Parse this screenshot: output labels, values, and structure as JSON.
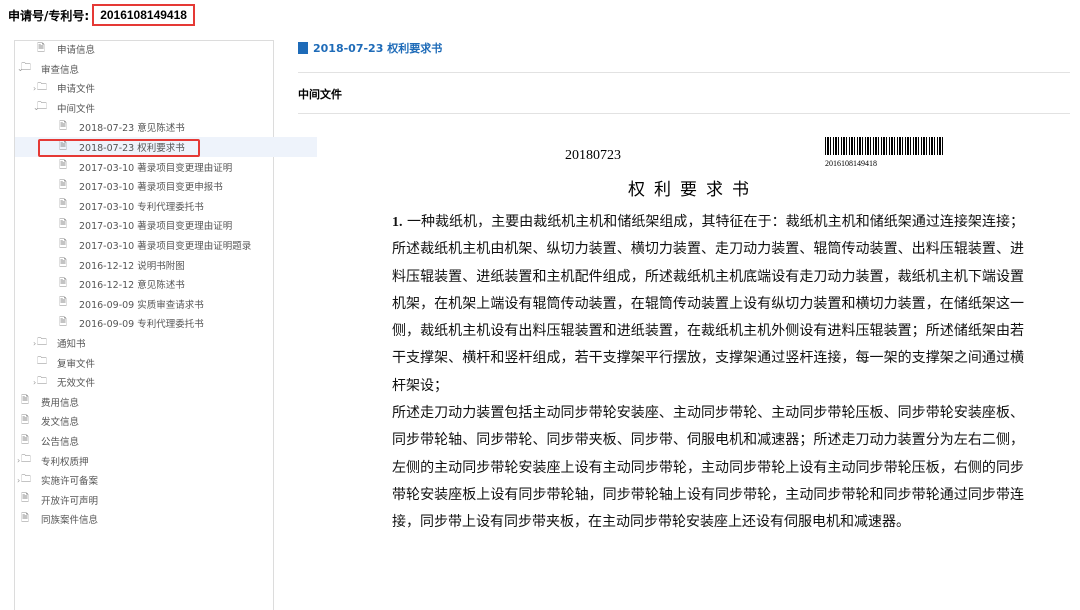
{
  "header": {
    "label": "申请号/专利号:",
    "number": "2016108149418"
  },
  "tree": [
    {
      "label": "申请信息",
      "icon": "doc",
      "arrow": ""
    },
    {
      "label": "审查信息",
      "icon": "folder",
      "arrow": "⌄"
    },
    {
      "label": "申请文件",
      "icon": "folder",
      "arrow": "›"
    },
    {
      "label": "中间文件",
      "icon": "folder",
      "arrow": "⌄"
    },
    {
      "label": "2018-07-23 意见陈述书",
      "icon": "doc",
      "arrow": ""
    },
    {
      "label": "2018-07-23 权利要求书",
      "icon": "doc",
      "arrow": ""
    },
    {
      "label": "2017-03-10 著录项目变更理由证明",
      "icon": "doc",
      "arrow": ""
    },
    {
      "label": "2017-03-10 著录项目变更申报书",
      "icon": "doc",
      "arrow": ""
    },
    {
      "label": "2017-03-10 专利代理委托书",
      "icon": "doc",
      "arrow": ""
    },
    {
      "label": "2017-03-10 著录项目变更理由证明",
      "icon": "doc",
      "arrow": ""
    },
    {
      "label": "2017-03-10 著录项目变更理由证明题录",
      "icon": "doc",
      "arrow": ""
    },
    {
      "label": "2016-12-12 说明书附图",
      "icon": "doc",
      "arrow": ""
    },
    {
      "label": "2016-12-12 意见陈述书",
      "icon": "doc",
      "arrow": ""
    },
    {
      "label": "2016-09-09 实质审查请求书",
      "icon": "doc",
      "arrow": ""
    },
    {
      "label": "2016-09-09 专利代理委托书",
      "icon": "doc",
      "arrow": ""
    },
    {
      "label": "通知书",
      "icon": "folder",
      "arrow": "›"
    },
    {
      "label": "复审文件",
      "icon": "folder",
      "arrow": ""
    },
    {
      "label": "无效文件",
      "icon": "folder",
      "arrow": "›"
    },
    {
      "label": "费用信息",
      "icon": "doc",
      "arrow": ""
    },
    {
      "label": "发文信息",
      "icon": "doc",
      "arrow": ""
    },
    {
      "label": "公告信息",
      "icon": "doc",
      "arrow": ""
    },
    {
      "label": "专利权质押",
      "icon": "folder",
      "arrow": "›"
    },
    {
      "label": "实施许可备案",
      "icon": "folder",
      "arrow": "›"
    },
    {
      "label": "开放许可声明",
      "icon": "doc",
      "arrow": ""
    },
    {
      "label": "同族案件信息",
      "icon": "doc",
      "arrow": ""
    }
  ],
  "document": {
    "title": "2018-07-23 权利要求书",
    "section": "中间文件",
    "date": "20180723",
    "barcode_number": "2016108149418",
    "heading": "权利要求书",
    "claim_num": "1.",
    "claim_p1": " 一种裁纸机，主要由裁纸机主机和储纸架组成，其特征在于：裁纸机主机和储纸架通过连接架连接；所述裁纸机主机由机架、纵切力装置、横切力装置、走刀动力装置、辊筒传动装置、出料压辊装置、进料压辊装置、进纸装置和主机配件组成，所述裁纸机主机底端设有走刀动力装置，裁纸机主机下端设置机架，在机架上端设有辊筒传动装置，在辊筒传动装置上设有纵切力装置和横切力装置，在储纸架这一侧，裁纸机主机设有出料压辊装置和进纸装置，在裁纸机主机外侧设有进料压辊装置；所述储纸架由若干支撑架、横杆和竖杆组成，若干支撑架平行摆放，支撑架通过竖杆连接，每一架的支撑架之间通过横杆架设；",
    "claim_p2": "所述走刀动力装置包括主动同步带轮安装座、主动同步带轮、主动同步带轮压板、同步带轮安装座板、同步带轮轴、同步带轮、同步带夹板、同步带、伺服电机和减速器；所述走刀动力装置分为左右二侧，左侧的主动同步带轮安装座上设有主动同步带轮，主动同步带轮上设有主动同步带轮压板，右侧的同步带轮安装座板上设有同步带轮轴，同步带轮轴上设有同步带轮，主动同步带轮和同步带轮通过同步带连接，同步带上设有同步带夹板，在主动同步带轮安装座上还设有伺服电机和减速器。"
  }
}
